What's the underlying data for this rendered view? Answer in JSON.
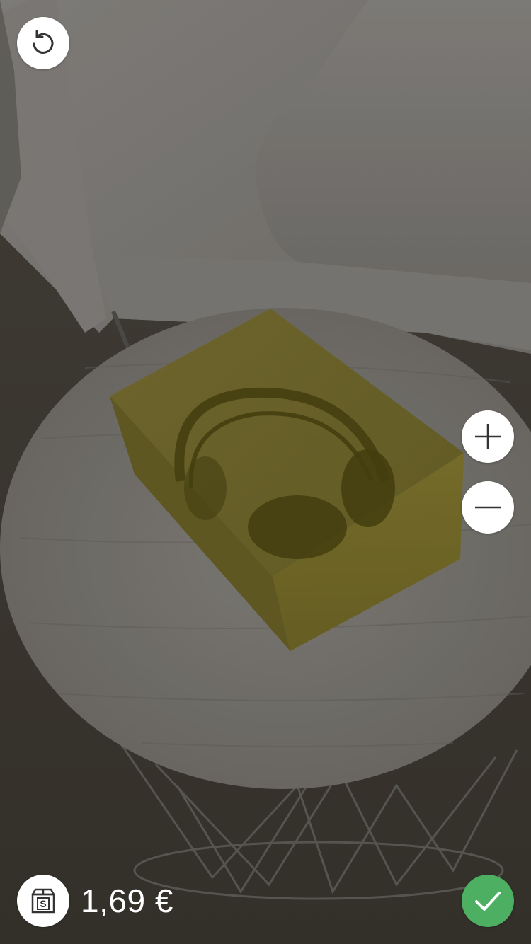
{
  "price": {
    "label": "1,69 €"
  },
  "icons": {
    "reset": "rotate-ccw-icon",
    "zoom_in": "plus-icon",
    "zoom_out": "minus-icon",
    "shipping": "shipping-box-icon",
    "confirm": "checkmark-icon"
  },
  "colors": {
    "button_background": "#ffffff",
    "confirm_green": "#4caf62",
    "price_text": "#ffffff",
    "ar_box_tint": "#a89a1c"
  }
}
